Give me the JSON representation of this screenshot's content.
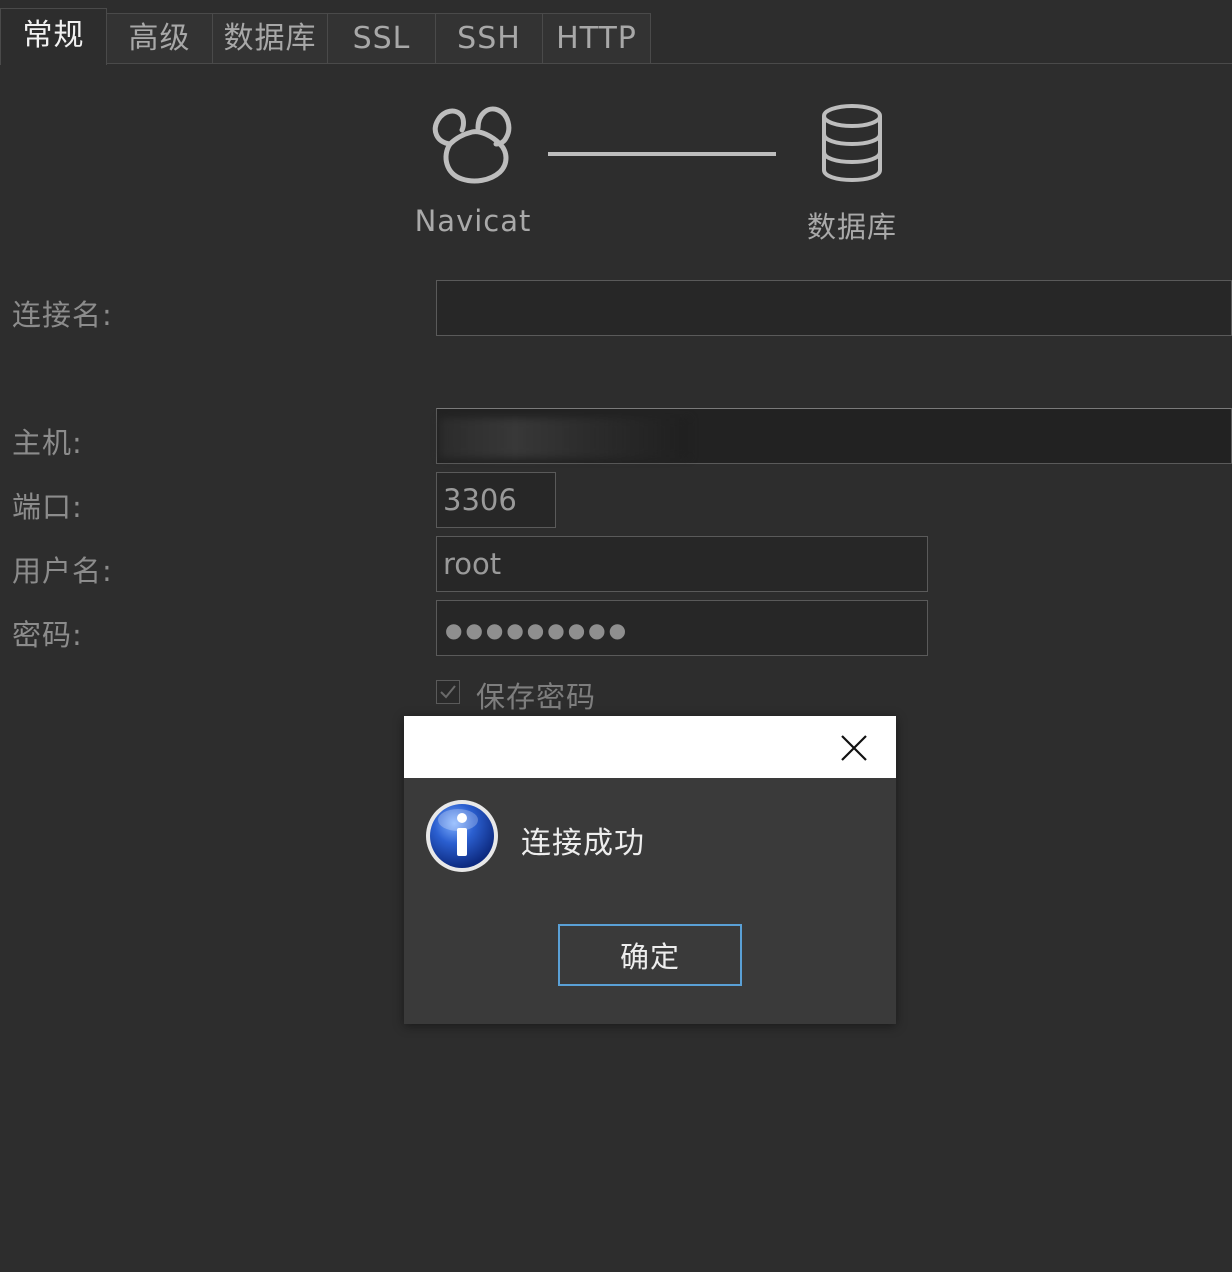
{
  "tabs": [
    {
      "label": "常规",
      "active": true
    },
    {
      "label": "高级",
      "active": false
    },
    {
      "label": "数据库",
      "active": false
    },
    {
      "label": "SSL",
      "active": false
    },
    {
      "label": "SSH",
      "active": false
    },
    {
      "label": "HTTP",
      "active": false
    }
  ],
  "header": {
    "left_label": "Navicat",
    "right_label": "数据库",
    "left_icon": "navicat-logo-icon",
    "right_icon": "database-icon"
  },
  "form": {
    "connection_name": {
      "label": "连接名:",
      "value": ""
    },
    "host": {
      "label": "主机:",
      "value": ""
    },
    "port": {
      "label": "端口:",
      "value": "3306"
    },
    "username": {
      "label": "用户名:",
      "value": "root"
    },
    "password": {
      "label": "密码:",
      "masked": "●●●●●●●●●"
    },
    "save_password": {
      "label": "保存密码",
      "checked": true
    }
  },
  "dialog": {
    "message": "连接成功",
    "ok_label": "确定",
    "icon": "info-icon",
    "close_icon": "close-icon"
  },
  "colors": {
    "background": "#2d2d2d",
    "dialog_bg": "#3a3a3a",
    "ok_border": "#5aa0d6",
    "info_blue": "#1f4fb8"
  }
}
